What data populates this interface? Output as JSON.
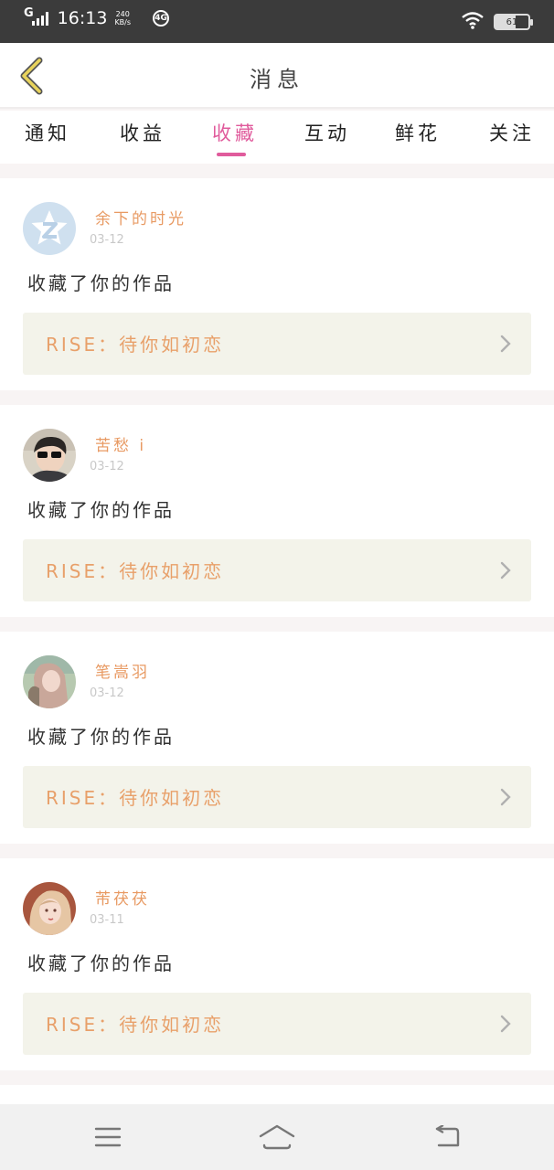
{
  "status_bar": {
    "network": "G",
    "time": "16:13",
    "speed_value": "240",
    "speed_unit": "KB/s",
    "hd_badge": "4G",
    "battery": "61"
  },
  "header": {
    "title": "消息"
  },
  "tabs": [
    {
      "label": "通知"
    },
    {
      "label": "收益"
    },
    {
      "label": "收藏"
    },
    {
      "label": "互动"
    },
    {
      "label": "鲜花"
    },
    {
      "label": "关注"
    }
  ],
  "active_tab": "收藏",
  "notifications": [
    {
      "username": "余下的时光",
      "date": "03-12",
      "action": "收藏了你的作品",
      "work": "RISE：待你如初恋",
      "avatar": "default-qq-avatar"
    },
    {
      "username": "苦愁 i",
      "date": "03-12",
      "action": "收藏了你的作品",
      "work": "RISE：待你如初恋",
      "avatar": "user-photo-avatar"
    },
    {
      "username": "笔嵩羽",
      "date": "03-12",
      "action": "收藏了你的作品",
      "work": "RISE：待你如初恋",
      "avatar": "user-photo-avatar"
    },
    {
      "username": "芾茯茯",
      "date": "03-11",
      "action": "收藏了你的作品",
      "work": "RISE：待你如初恋",
      "avatar": "user-photo-avatar"
    }
  ],
  "colors": {
    "accent": "#e05b9c",
    "username": "#e89a63",
    "work_title": "#e8a06a",
    "work_bg": "#f3f3ea",
    "back_arrow": "#e8d35c"
  }
}
